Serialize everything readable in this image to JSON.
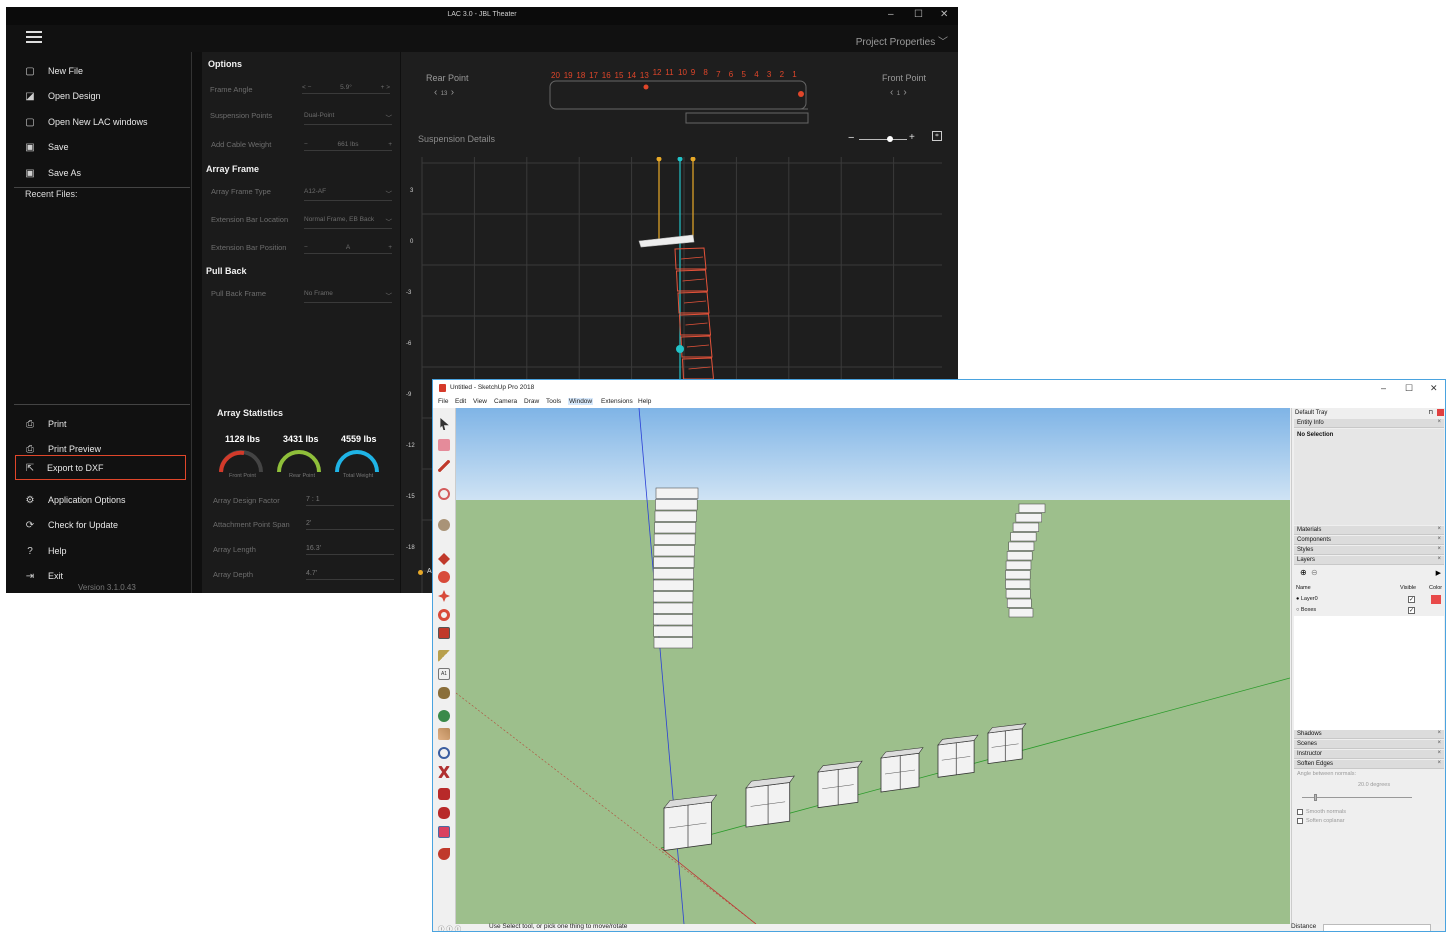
{
  "lac": {
    "title": "LAC 3.0 - JBL Theater",
    "project_properties": "Project Properties",
    "menu": [
      {
        "label": "New File",
        "icon": "new-file-icon"
      },
      {
        "label": "Open Design",
        "icon": "open-design-icon"
      },
      {
        "label": "Open New LAC windows",
        "icon": "new-window-icon"
      },
      {
        "label": "Save",
        "icon": "save-icon"
      },
      {
        "label": "Save As",
        "icon": "save-as-icon"
      }
    ],
    "recent_files": "Recent Files:",
    "bottom_menu": [
      {
        "label": "Print",
        "icon": "print-icon"
      },
      {
        "label": "Print Preview",
        "icon": "print-preview-icon"
      },
      {
        "label": "Export to DXF",
        "icon": "export-icon"
      },
      {
        "label": "Application Options",
        "icon": "gear-icon"
      },
      {
        "label": "Check for Update",
        "icon": "update-icon"
      },
      {
        "label": "Help",
        "icon": "help-icon"
      },
      {
        "label": "Exit",
        "icon": "exit-icon"
      }
    ],
    "version": "Version 3.1.0.43",
    "options": {
      "heading": "Options",
      "frame_angle_label": "Frame Angle",
      "frame_angle_value": "5.9°",
      "suspension_points_label": "Suspension Points",
      "suspension_points_value": "Dual-Point",
      "add_cable_weight_label": "Add Cable Weight",
      "add_cable_weight_value": "661 lbs",
      "array_frame_heading": "Array Frame",
      "array_frame_type_label": "Array Frame Type",
      "array_frame_type_value": "A12-AF",
      "ext_bar_location_label": "Extension Bar Location",
      "ext_bar_location_value": "Normal Frame, EB Back",
      "ext_bar_position_label": "Extension Bar Position",
      "ext_bar_position_value": "A",
      "pull_back_heading": "Pull Back",
      "pull_back_frame_label": "Pull Back Frame",
      "pull_back_frame_value": "No Frame"
    },
    "stats": {
      "heading": "Array Statistics",
      "front": "1128 lbs",
      "front_caption": "Front Point",
      "rear": "3431 lbs",
      "rear_caption": "Rear Point",
      "total": "4559 lbs",
      "total_caption": "Total Weight",
      "design_factor_label": "Array Design Factor",
      "design_factor_value": "7 : 1",
      "attachment_span_label": "Attachment Point Span",
      "attachment_span_value": "2'",
      "array_length_label": "Array Length",
      "array_length_value": "16.3'",
      "array_depth_label": "Array Depth",
      "array_depth_value": "4.7'"
    },
    "rear_point_label": "Rear Point",
    "rear_point_value": "13",
    "front_point_label": "Front Point",
    "front_point_value": "1",
    "frame_numbers": [
      "20",
      "19",
      "18",
      "17",
      "16",
      "15",
      "14",
      "13",
      "12",
      "11",
      "10",
      "9",
      "8",
      "7",
      "6",
      "5",
      "4",
      "3",
      "2",
      "1"
    ],
    "suspension_details": "Suspension Details",
    "y_ticks": [
      "3",
      "0",
      "-3",
      "-6",
      "-9",
      "-12",
      "-15",
      "-18"
    ],
    "legend_fragment": "A"
  },
  "su": {
    "title": "Untitled - SketchUp Pro 2018",
    "menu": [
      "File",
      "Edit",
      "View",
      "Camera",
      "Draw",
      "Tools",
      "Window",
      "Extensions",
      "Help"
    ],
    "tray_title": "Default Tray",
    "entity_info": "Entity Info",
    "no_selection": "No Selection",
    "panels_mid": [
      "Materials",
      "Components",
      "Styles",
      "Layers"
    ],
    "layers_header_name": "Name",
    "layers_header_visible": "Visible",
    "layers_header_color": "Color",
    "layers": [
      {
        "name": "Layer0",
        "color": "#e84a4a"
      },
      {
        "name": "Boxes",
        "color": "#ffffff"
      }
    ],
    "panels_bottom": [
      "Shadows",
      "Scenes",
      "Instructor",
      "Soften Edges"
    ],
    "soften": {
      "angle_label": "Angle between normals:",
      "angle_value": "20.0  degrees",
      "smooth_normals": "Smooth normals",
      "soften_coplanar": "Soften coplanar"
    },
    "status_text": "Use Select tool, or pick one thing to move/rotate",
    "distance_label": "Distance"
  },
  "colors": {
    "accent": "#e0462a",
    "cyan": "#1fb4e6",
    "green": "#8fbf3a",
    "red": "#d23a2a",
    "sky": "#7fb4e6",
    "ground": "#9dbf8c"
  }
}
